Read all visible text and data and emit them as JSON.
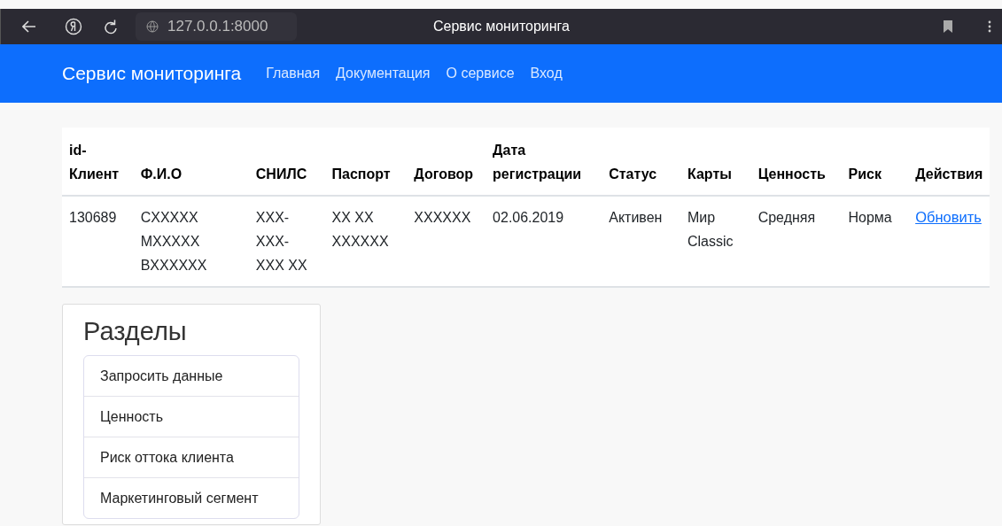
{
  "browser": {
    "url": "127.0.0.1:8000",
    "title": "Сервис мониторинга"
  },
  "navbar": {
    "brand": "Сервис мониторинга",
    "links": [
      "Главная",
      "Документация",
      "О сервисе",
      "Вход"
    ]
  },
  "table": {
    "columns": [
      "id- Клиент",
      "Ф.И.О",
      "СНИЛС",
      "Паспорт",
      "Договор",
      "Дата регистрации",
      "Статус",
      "Карты",
      "Ценность",
      "Риск",
      "Действия"
    ],
    "rows": [
      {
        "cells": [
          "130689",
          "СXXXXX MXXXXX BXXXXXX",
          "XXX- XXX- XXX XX",
          "XX XX XXXXXX",
          "XXXXXX",
          "02.06.2019",
          "Активен",
          "Мир Classic",
          "Средняя",
          "Норма"
        ],
        "action": "Обновить"
      }
    ]
  },
  "sections": {
    "title": "Разделы",
    "items": [
      "Запросить данные",
      "Ценность",
      "Риск оттока клиента",
      "Маркетинговый сегмент"
    ]
  }
}
